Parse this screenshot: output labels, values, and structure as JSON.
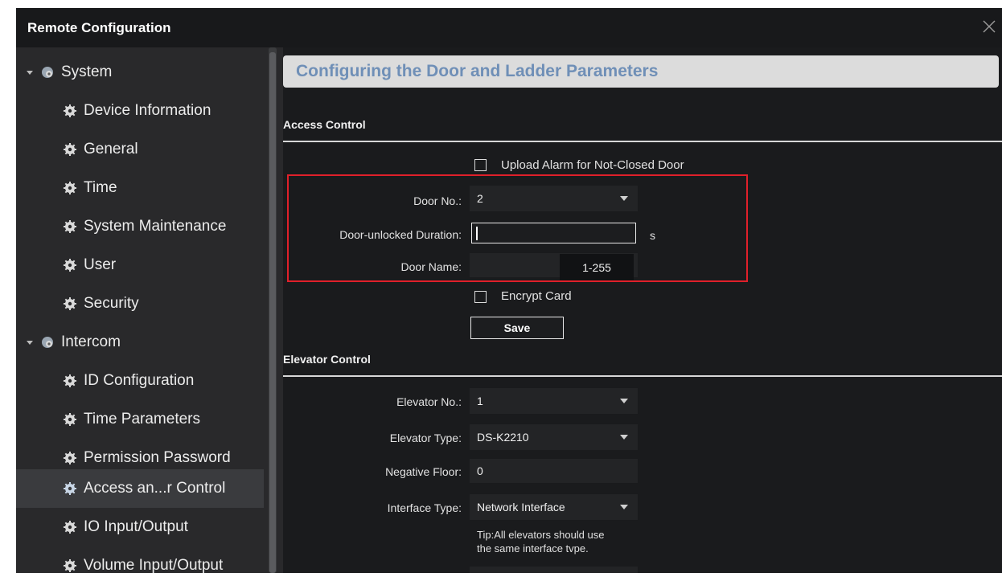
{
  "window": {
    "title": "Remote Configuration",
    "close_icon": "close-icon"
  },
  "sidebar": {
    "items": [
      {
        "label": "System",
        "level": 0,
        "expanded": true,
        "icon": "gear-group-icon"
      },
      {
        "label": "Device Information",
        "level": 1,
        "icon": "gear-icon"
      },
      {
        "label": "General",
        "level": 1,
        "icon": "gear-icon"
      },
      {
        "label": "Time",
        "level": 1,
        "icon": "gear-icon"
      },
      {
        "label": "System Maintenance",
        "level": 1,
        "icon": "gear-icon"
      },
      {
        "label": "User",
        "level": 1,
        "icon": "gear-icon"
      },
      {
        "label": "Security",
        "level": 1,
        "icon": "gear-icon"
      },
      {
        "label": "Intercom",
        "level": 0,
        "expanded": true,
        "icon": "gear-group-icon"
      },
      {
        "label": "ID Configuration",
        "level": 1,
        "icon": "gear-icon"
      },
      {
        "label": "Time Parameters",
        "level": 1,
        "icon": "gear-icon"
      },
      {
        "label": "Permission Password",
        "level": 1,
        "icon": "gear-icon"
      },
      {
        "label": "Access an...r Control",
        "level": 1,
        "icon": "gear-icon",
        "selected": true
      },
      {
        "label": "IO Input/Output",
        "level": 1,
        "icon": "gear-icon"
      },
      {
        "label": "Volume Input/Output",
        "level": 1,
        "icon": "gear-icon"
      }
    ]
  },
  "main": {
    "page_title": "Configuring the Door and Ladder Parameters",
    "access_control": {
      "section_title": "Access Control",
      "upload_alarm_label": "Upload Alarm for Not-Closed Door",
      "upload_alarm_checked": false,
      "door_no_label": "Door No.:",
      "door_no_value": "2",
      "unlock_duration_label": "Door-unlocked Duration:",
      "unlock_duration_value": "",
      "unlock_duration_unit": "s",
      "door_name_label": "Door Name:",
      "door_name_value": "",
      "door_name_tooltip": "1-255",
      "encrypt_card_label": "Encrypt Card",
      "encrypt_card_checked": false,
      "save_label": "Save"
    },
    "elevator_control": {
      "section_title": "Elevator Control",
      "elevator_no_label": "Elevator No.:",
      "elevator_no_value": "1",
      "elevator_type_label": "Elevator Type:",
      "elevator_type_value": "DS-K2210",
      "negative_floor_label": "Negative Floor:",
      "negative_floor_value": "0",
      "interface_type_label": "Interface Type:",
      "interface_type_value": "Network Interface",
      "tip_line1": "Tip:All elevators should use",
      "tip_line2": "the same interface tvpe."
    }
  },
  "colors": {
    "highlight": "#e0202a",
    "page_title": "#6f8fb7",
    "header_bg": "#dcdcdc",
    "panel_bg": "#1a1b1d",
    "sidebar_bg": "#29292b"
  }
}
